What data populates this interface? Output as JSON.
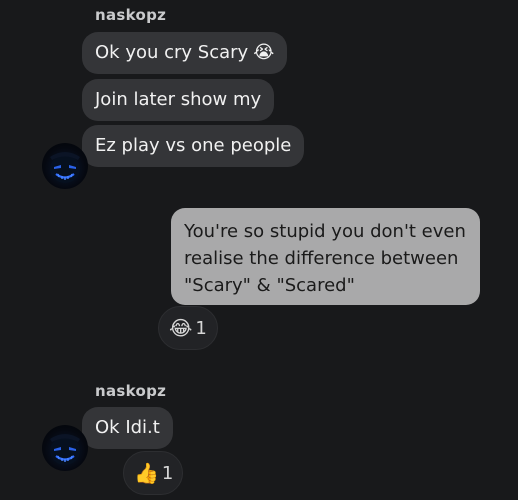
{
  "groups": [
    {
      "sender": "naskopz",
      "messages": [
        {
          "text": "Ok you cry Scary",
          "emoji": "😭"
        },
        {
          "text": "Join later show my",
          "emoji": ""
        },
        {
          "text": "Ez play vs one people",
          "emoji": ""
        }
      ]
    },
    {
      "sender": "naskopz",
      "messages": [
        {
          "text": "Ok Idi.t",
          "emoji": ""
        }
      ]
    }
  ],
  "outgoing": {
    "text": "You're so stupid you don't even realise the difference between \"Scary\" & \"Scared\"",
    "reaction": {
      "emoji": "😂",
      "count": "1"
    }
  },
  "incoming_reaction": {
    "emoji": "👍",
    "count": "1"
  },
  "colors": {
    "background": "#18191b",
    "incoming_bubble": "#343538",
    "outgoing_bubble": "#a9a9aa",
    "avatar_glow": "#2f6bff"
  }
}
